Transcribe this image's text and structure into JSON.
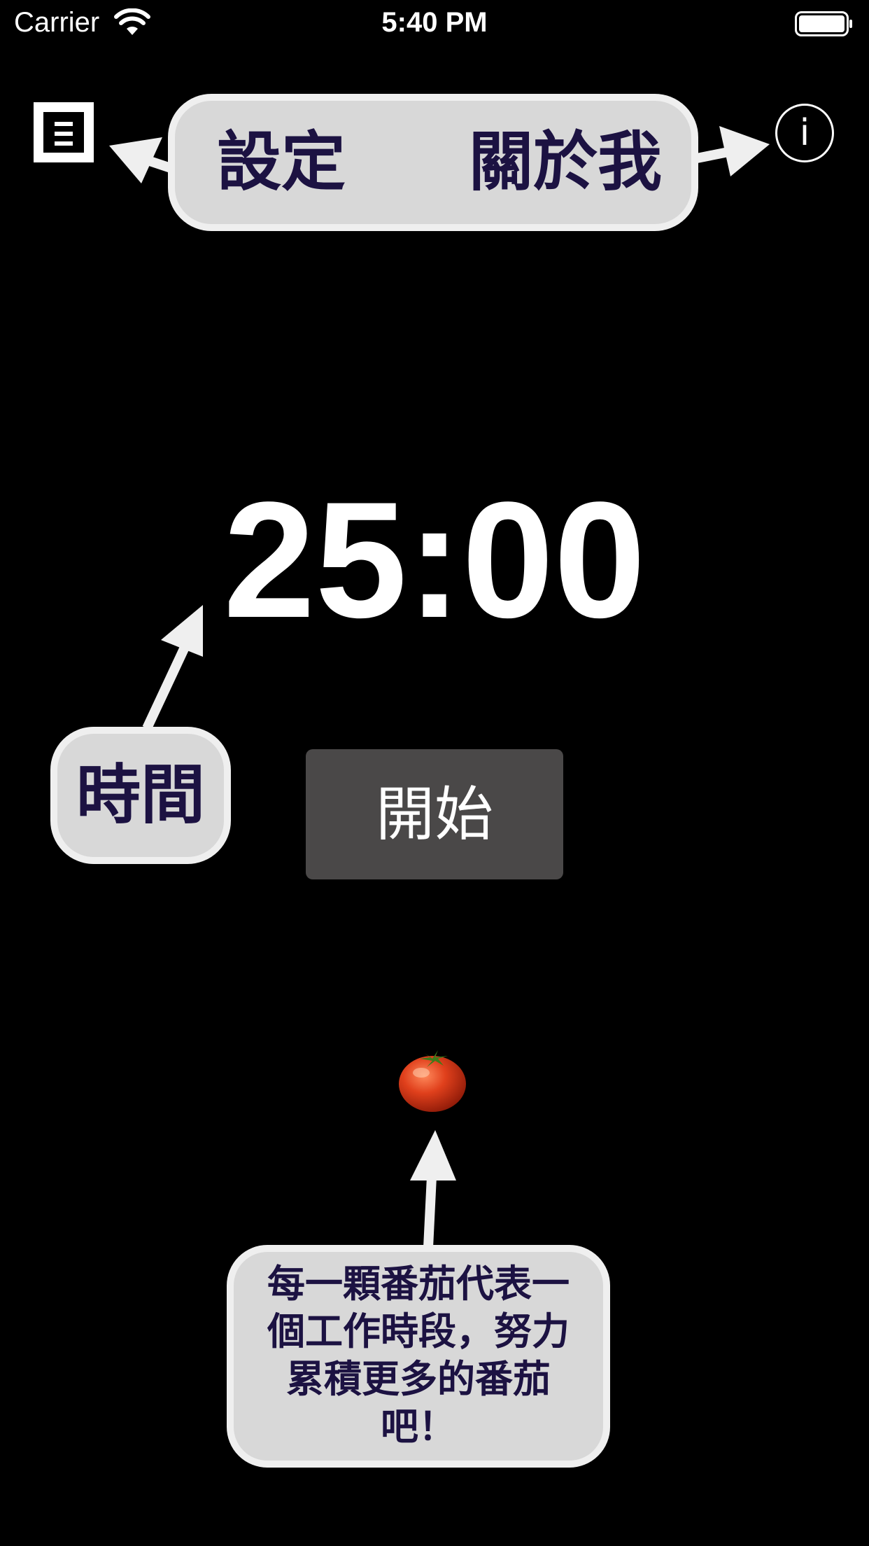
{
  "status_bar": {
    "carrier": "Carrier",
    "time": "5:40 PM"
  },
  "icons": {
    "menu": "menu-list-icon",
    "info": "info-icon",
    "info_glyph": "i",
    "tomato": "tomato-icon"
  },
  "callouts": {
    "settings": "設定",
    "about": "關於我",
    "time": "時間",
    "tomato_tip": "每一顆番茄代表一個工作時段，努力累積更多的番茄吧！"
  },
  "timer": {
    "display": "25:00"
  },
  "start_button": {
    "label": "開始"
  },
  "colors": {
    "background": "#000000",
    "bubble_fill": "#d8d8d8",
    "bubble_border": "#efefef",
    "bubble_text": "#1c1242",
    "button": "#4a4848"
  }
}
